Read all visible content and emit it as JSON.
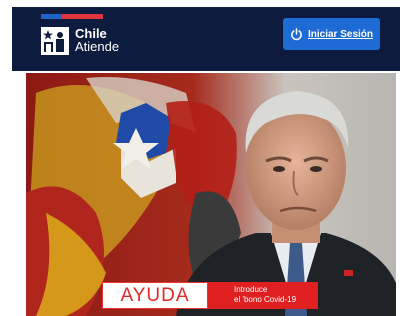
{
  "header": {
    "logo_line1": "Chile",
    "logo_line2": "Atiende",
    "login_label": "Iniciar Sesión",
    "login_icon": "power-icon",
    "colors": {
      "background": "#0d1b3e",
      "button": "#1f6bd6",
      "flag_blue": "#1e63c8",
      "flag_red": "#e0353f"
    }
  },
  "hero": {
    "banner_big": "AYUDA",
    "banner_line1": "Introduce",
    "banner_line2": "el 'bono Covid-19"
  }
}
